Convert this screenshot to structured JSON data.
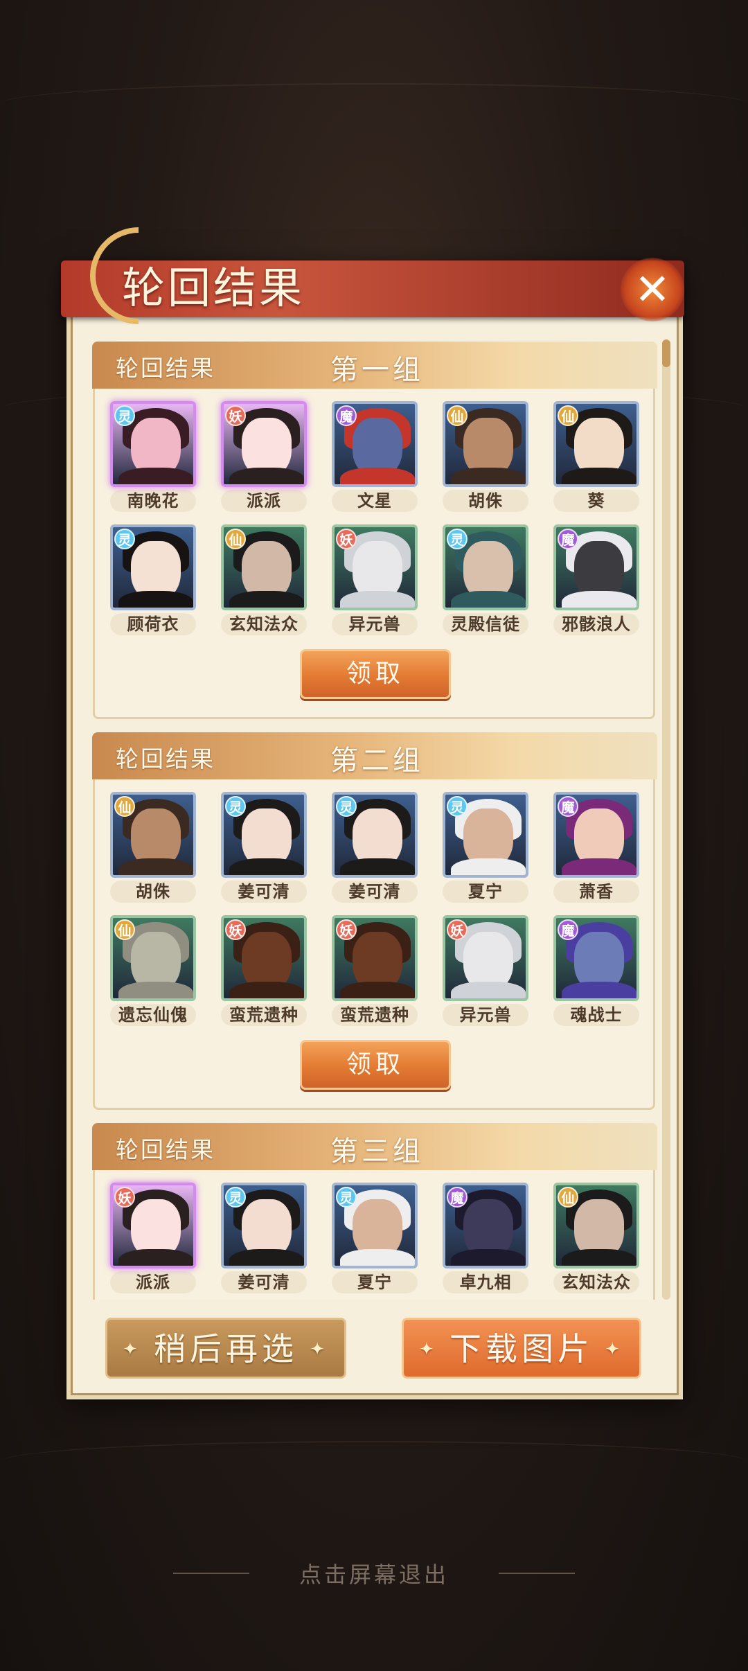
{
  "dialog": {
    "title": "轮回结果",
    "close_icon": "close-icon"
  },
  "groups": [
    {
      "label": "轮回结果",
      "name": "第一组",
      "claim_label": "领取",
      "cards": [
        {
          "name": "南晚花",
          "badge": "灵",
          "badge_color": "#5cc7f0",
          "frame": "purple",
          "tone": "#f2b7c7",
          "hair": "#3a1d24"
        },
        {
          "name": "派派",
          "badge": "妖",
          "badge_color": "#e86a5a",
          "frame": "purple",
          "tone": "#fbe2e0",
          "hair": "#2b2020"
        },
        {
          "name": "文星",
          "badge": "魔",
          "badge_color": "#a05bd6",
          "frame": "blue",
          "tone": "#5a6aa0",
          "hair": "#c4362b"
        },
        {
          "name": "胡侏",
          "badge": "仙",
          "badge_color": "#e2a83c",
          "frame": "blue",
          "tone": "#b98a6a",
          "hair": "#3b2a22"
        },
        {
          "name": "葵",
          "badge": "仙",
          "badge_color": "#e2a83c",
          "frame": "blue",
          "tone": "#f2dcc8",
          "hair": "#1e1a18"
        },
        {
          "name": "顾荷衣",
          "badge": "灵",
          "badge_color": "#5cc7f0",
          "frame": "blue",
          "tone": "#f4e1d3",
          "hair": "#171313"
        },
        {
          "name": "玄知法众",
          "badge": "仙",
          "badge_color": "#e2a83c",
          "frame": "green",
          "tone": "#d2b8a6",
          "hair": "#1b1b1b"
        },
        {
          "name": "异元兽",
          "badge": "妖",
          "badge_color": "#e86a5a",
          "frame": "green",
          "tone": "#e8e8ea",
          "hair": "#cfd2d6"
        },
        {
          "name": "灵殿信徒",
          "badge": "灵",
          "badge_color": "#5cc7f0",
          "frame": "green",
          "tone": "#d8c0ad",
          "hair": "#2f5a5e"
        },
        {
          "name": "邪骸浪人",
          "badge": "魔",
          "badge_color": "#a05bd6",
          "frame": "green",
          "tone": "#3b3b40",
          "hair": "#e9e9ee"
        }
      ]
    },
    {
      "label": "轮回结果",
      "name": "第二组",
      "claim_label": "领取",
      "cards": [
        {
          "name": "胡侏",
          "badge": "仙",
          "badge_color": "#e2a83c",
          "frame": "blue",
          "tone": "#b98a6a",
          "hair": "#3b2a22"
        },
        {
          "name": "姜可清",
          "badge": "灵",
          "badge_color": "#5cc7f0",
          "frame": "blue",
          "tone": "#f2ddd0",
          "hair": "#1d1a1a"
        },
        {
          "name": "姜可清",
          "badge": "灵",
          "badge_color": "#5cc7f0",
          "frame": "blue",
          "tone": "#f2ddd0",
          "hair": "#1d1a1a"
        },
        {
          "name": "夏宁",
          "badge": "灵",
          "badge_color": "#5cc7f0",
          "frame": "blue",
          "tone": "#d9b39a",
          "hair": "#eeeeee"
        },
        {
          "name": "萧香",
          "badge": "魔",
          "badge_color": "#a05bd6",
          "frame": "blue",
          "tone": "#f0cbb9",
          "hair": "#7b2a7a"
        },
        {
          "name": "遗忘仙傀",
          "badge": "仙",
          "badge_color": "#e2a83c",
          "frame": "green",
          "tone": "#b8b7a6",
          "hair": "#8f8e80"
        },
        {
          "name": "蛮荒遗种",
          "badge": "妖",
          "badge_color": "#e86a5a",
          "frame": "green",
          "tone": "#6d3a24",
          "hair": "#3a2015"
        },
        {
          "name": "蛮荒遗种",
          "badge": "妖",
          "badge_color": "#e86a5a",
          "frame": "green",
          "tone": "#6d3a24",
          "hair": "#3a2015"
        },
        {
          "name": "异元兽",
          "badge": "妖",
          "badge_color": "#e86a5a",
          "frame": "green",
          "tone": "#e8e8ea",
          "hair": "#cfd2d6"
        },
        {
          "name": "魂战士",
          "badge": "魔",
          "badge_color": "#a05bd6",
          "frame": "green",
          "tone": "#6c7cb6",
          "hair": "#4a3fa0"
        }
      ]
    },
    {
      "label": "轮回结果",
      "name": "第三组",
      "claim_label": "领取",
      "cards": [
        {
          "name": "派派",
          "badge": "妖",
          "badge_color": "#e86a5a",
          "frame": "purple",
          "tone": "#fbe2e0",
          "hair": "#2b2020"
        },
        {
          "name": "姜可清",
          "badge": "灵",
          "badge_color": "#5cc7f0",
          "frame": "blue",
          "tone": "#f2ddd0",
          "hair": "#1d1a1a"
        },
        {
          "name": "夏宁",
          "badge": "灵",
          "badge_color": "#5cc7f0",
          "frame": "blue",
          "tone": "#d9b39a",
          "hair": "#eeeeee"
        },
        {
          "name": "卓九相",
          "badge": "魔",
          "badge_color": "#a05bd6",
          "frame": "blue",
          "tone": "#3d3a5a",
          "hair": "#1c1a2c"
        },
        {
          "name": "玄知法众",
          "badge": "仙",
          "badge_color": "#e2a83c",
          "frame": "green",
          "tone": "#d2b8a6",
          "hair": "#1b1b1b"
        }
      ]
    }
  ],
  "footer": {
    "later_label": "稍后再选",
    "download_label": "下载图片",
    "deco_icon": "diamond-icon"
  },
  "exit_hint": "点击屏幕退出"
}
